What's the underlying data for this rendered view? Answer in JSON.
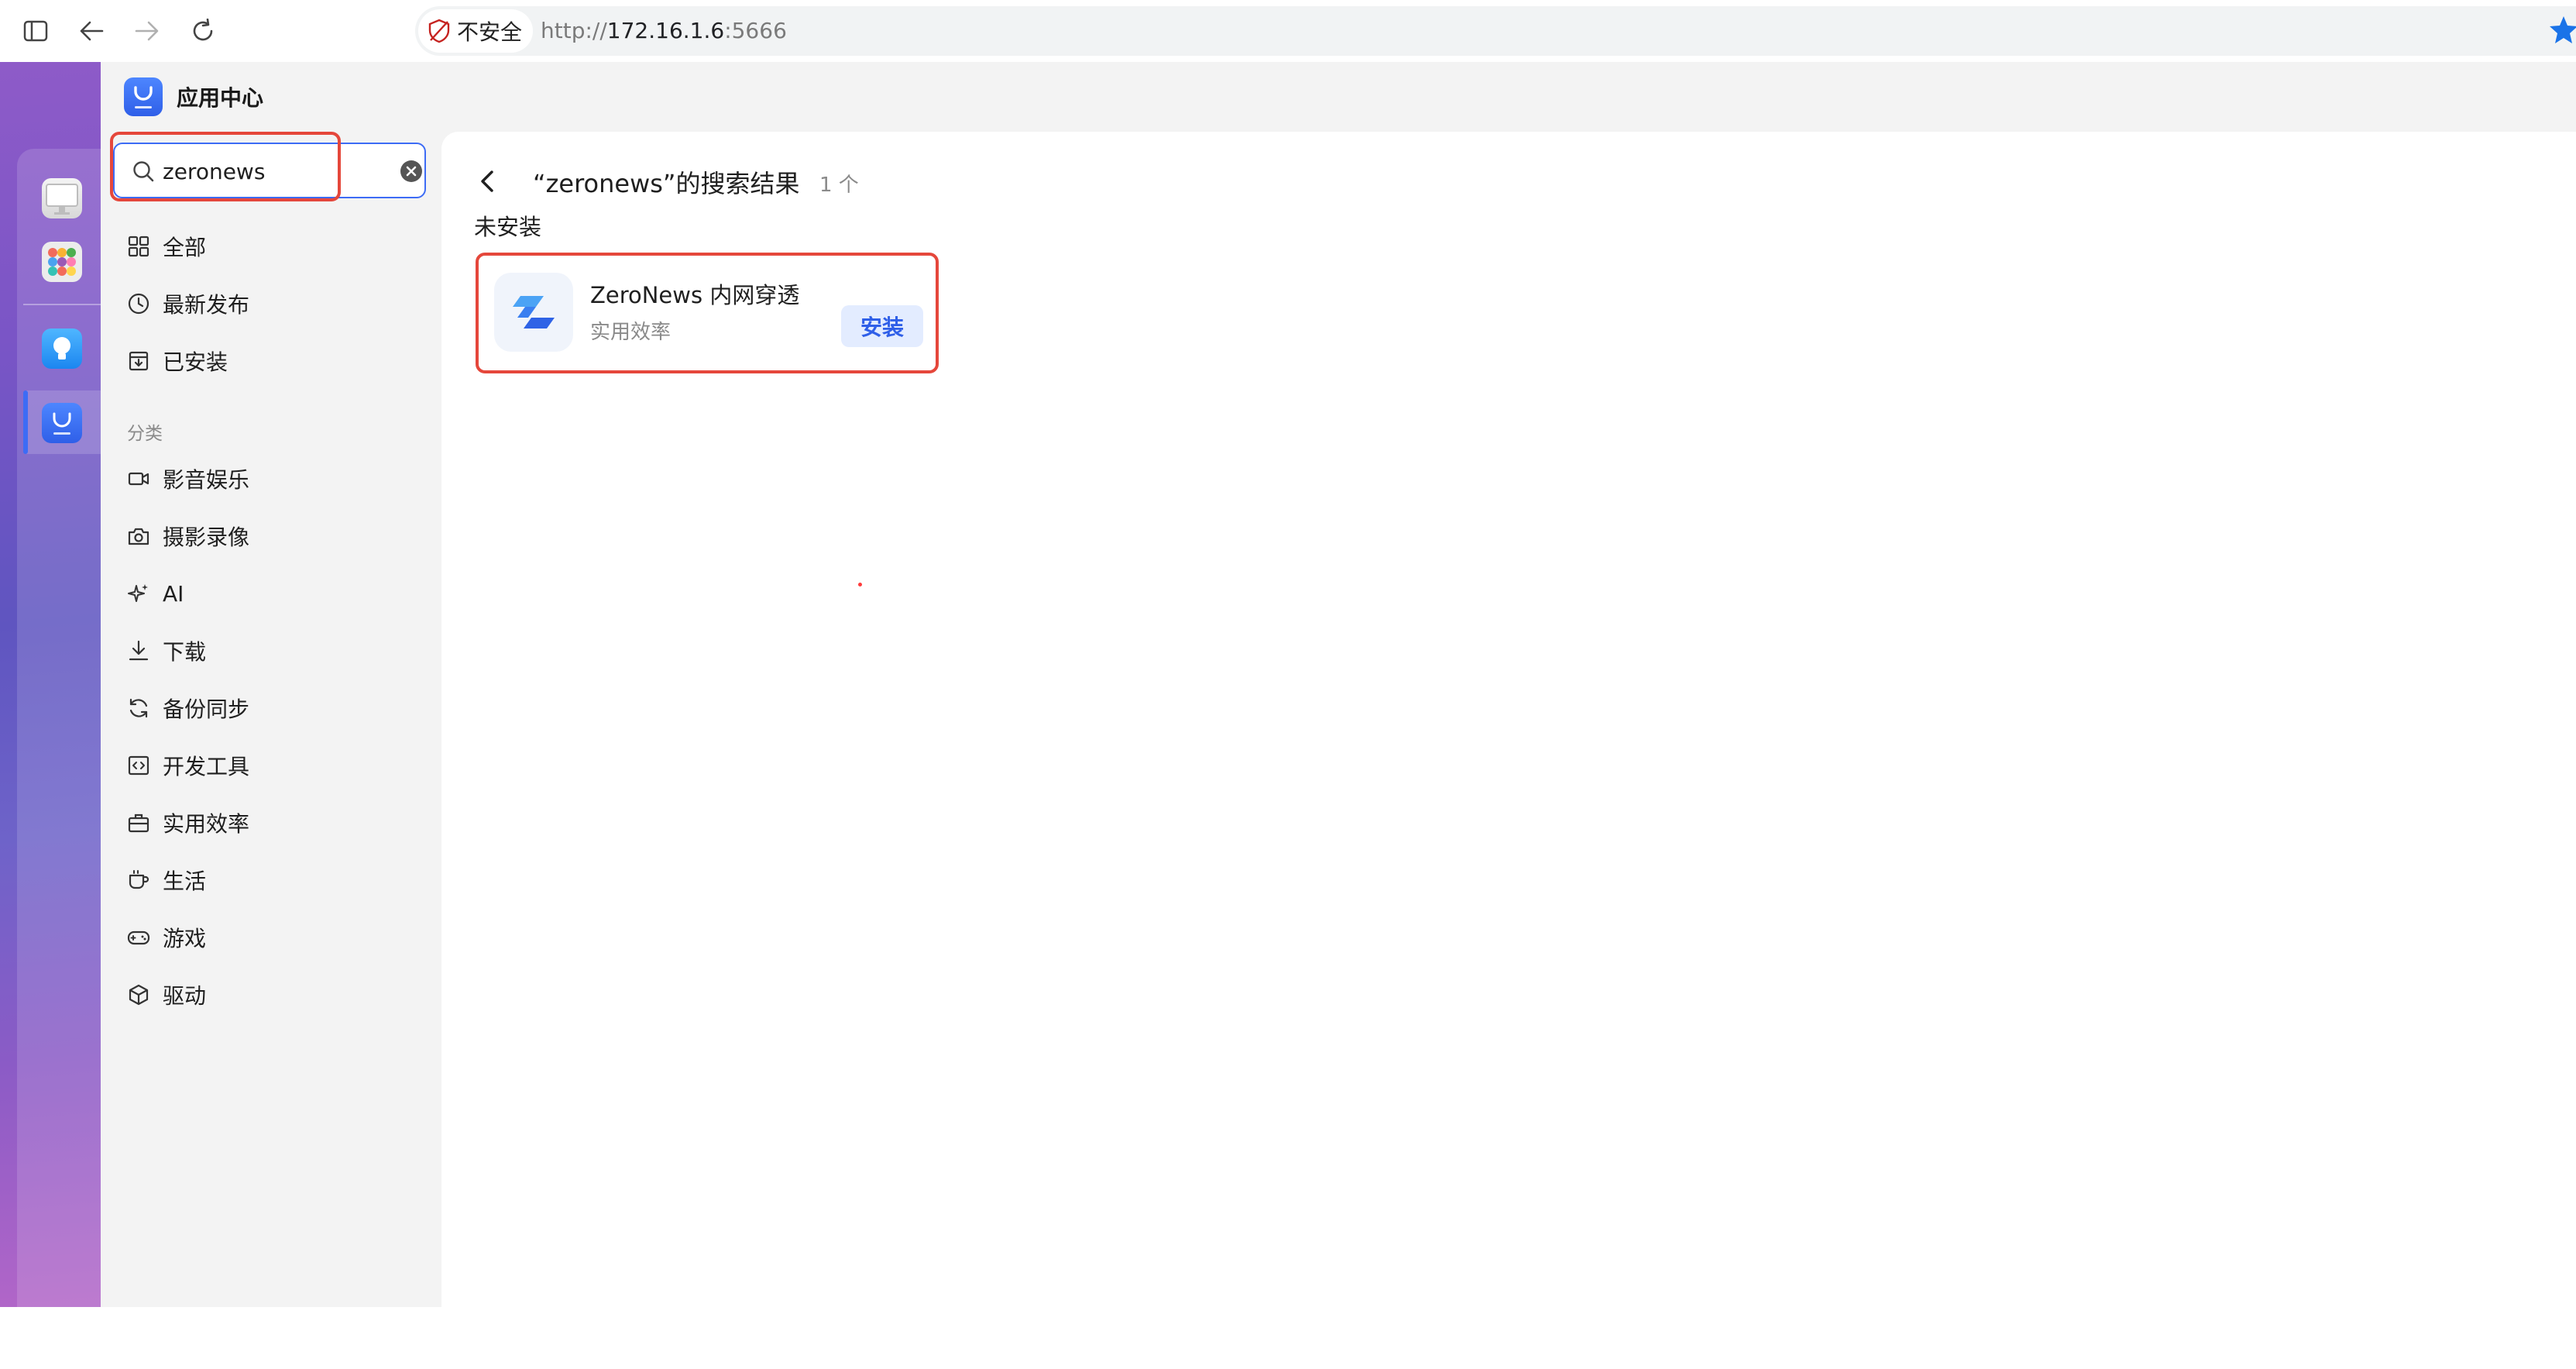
{
  "browser": {
    "security_label": "不安全",
    "url_scheme": "http://",
    "url_host": "172.16.1.6",
    "url_port": ":5666"
  },
  "app": {
    "title": "应用中心"
  },
  "search": {
    "value": "zeronews"
  },
  "sidebar": {
    "items": [
      {
        "label": "全部",
        "icon": "grid-icon"
      },
      {
        "label": "最新发布",
        "icon": "clock-icon"
      },
      {
        "label": "已安装",
        "icon": "installed-box-icon"
      }
    ],
    "section_label": "分类",
    "categories": [
      {
        "label": "影音娱乐",
        "icon": "video-camera-icon"
      },
      {
        "label": "摄影录像",
        "icon": "camera-icon"
      },
      {
        "label": "AI",
        "icon": "sparkle-icon"
      },
      {
        "label": "下载",
        "icon": "download-icon"
      },
      {
        "label": "备份同步",
        "icon": "sync-icon"
      },
      {
        "label": "开发工具",
        "icon": "code-icon"
      },
      {
        "label": "实用效率",
        "icon": "briefcase-icon"
      },
      {
        "label": "生活",
        "icon": "cup-icon"
      },
      {
        "label": "游戏",
        "icon": "gamepad-icon"
      },
      {
        "label": "驱动",
        "icon": "cube-icon"
      }
    ]
  },
  "results": {
    "title": "“zeronews”的搜索结果",
    "count": "1 个",
    "section": "未安装",
    "apps": [
      {
        "name": "ZeroNews 内网穿透",
        "category": "实用效率",
        "action": "安装"
      }
    ]
  },
  "colors": {
    "accent": "#3d6cf5",
    "highlight": "#e5473b",
    "install_bg": "#e3ecff"
  }
}
